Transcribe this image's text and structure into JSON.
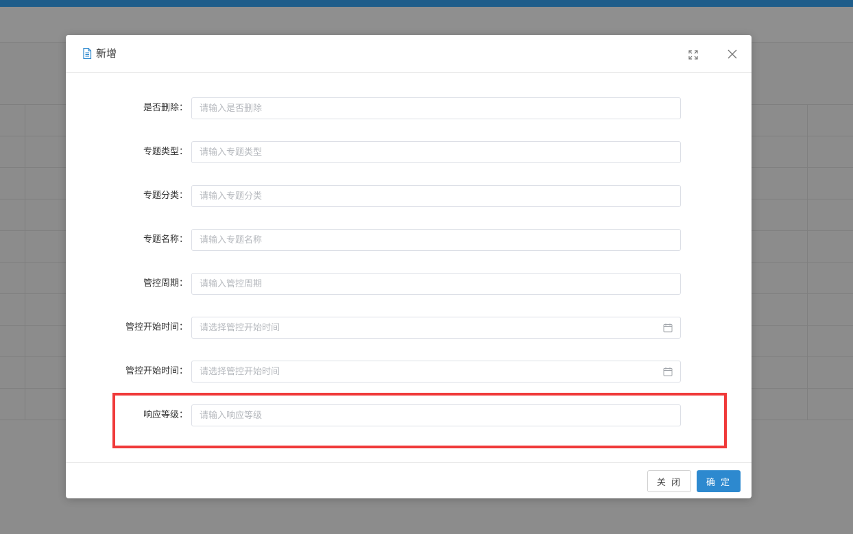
{
  "dialog": {
    "title": "新增",
    "icons": {
      "title": "document-icon",
      "maximize": "maximize-icon",
      "close": "close-icon"
    }
  },
  "form": {
    "fields": [
      {
        "label": "是否删除：",
        "placeholder": "请输入是否删除",
        "value": "",
        "type": "text"
      },
      {
        "label": "专题类型：",
        "placeholder": "请输入专题类型",
        "value": "",
        "type": "text"
      },
      {
        "label": "专题分类：",
        "placeholder": "请输入专题分类",
        "value": "",
        "type": "text"
      },
      {
        "label": "专题名称：",
        "placeholder": "请输入专题名称",
        "value": "",
        "type": "text"
      },
      {
        "label": "管控周期：",
        "placeholder": "请输入管控周期",
        "value": "",
        "type": "text"
      },
      {
        "label": "管控开始时间：",
        "placeholder": "请选择管控开始时间",
        "value": "",
        "type": "date"
      },
      {
        "label": "管控开始时间：",
        "placeholder": "请选择管控开始时间",
        "value": "",
        "type": "date"
      },
      {
        "label": "响应等级：",
        "placeholder": "请输入响应等级",
        "value": "",
        "type": "text"
      }
    ]
  },
  "footer": {
    "cancel_label": "关 闭",
    "ok_label": "确 定"
  },
  "colors": {
    "primary": "#2d89cf",
    "topbar": "#1f5d8a",
    "highlight": "#f03a3a",
    "overlay": "#8c8c8c"
  }
}
